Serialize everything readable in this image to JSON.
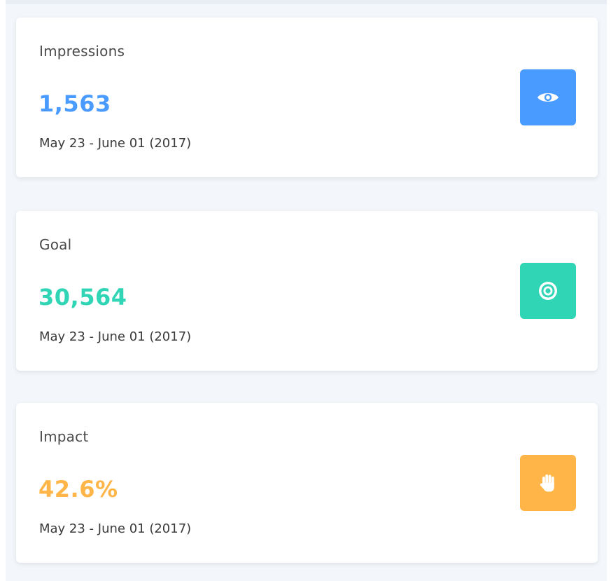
{
  "cards": [
    {
      "title": "Impressions",
      "value": "1,563",
      "range": "May 23 - June 01 (2017)",
      "color": "#4a9bff",
      "icon": "eye-icon"
    },
    {
      "title": "Goal",
      "value": "30,564",
      "range": "May 23 - June 01 (2017)",
      "color": "#2fd5b5",
      "icon": "target-icon"
    },
    {
      "title": "Impact",
      "value": "42.6%",
      "range": "May 23 - June 01 (2017)",
      "color": "#ffb547",
      "icon": "hand-icon"
    }
  ]
}
